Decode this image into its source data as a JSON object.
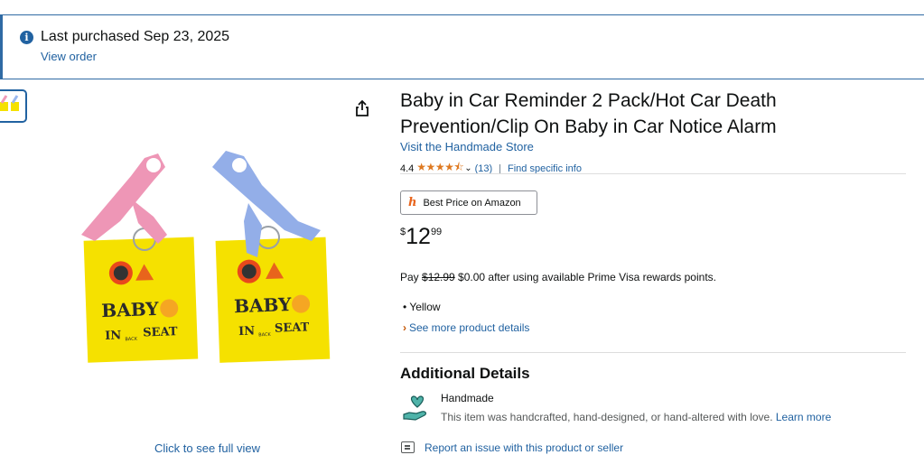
{
  "banner": {
    "icon": "info-icon",
    "title": "Last purchased Sep 23, 2025",
    "link": "View order"
  },
  "product": {
    "title": "Baby in Car Reminder 2 Pack/Hot Car Death Prevention/Clip On Baby in Car Notice Alarm",
    "store_link": "Visit the Handmade Store",
    "rating": "4.4",
    "stars": "★★★★⯪",
    "review_count": "(13)",
    "separator": "|",
    "find_info": "Find specific info",
    "best_price_label": "Best Price on Amazon",
    "price": {
      "symbol": "$",
      "whole": "12",
      "fraction": "99"
    },
    "pay_line": {
      "prefix": "Pay ",
      "strike": "$12.99",
      "suffix": " $0.00 after using available Prime Visa rewards points."
    },
    "bullets": [
      "• Yellow"
    ],
    "see_more": "See more product details",
    "image_link": "Click to see full view",
    "image_label_1": "BABY",
    "image_label_2": "IN",
    "image_label_3": "BACK",
    "image_label_4": "SEAT"
  },
  "additional": {
    "title": "Additional Details",
    "handmade_title": "Handmade",
    "handmade_desc": "This item was handcrafted, hand-designed, or hand-altered with love. ",
    "learn_more": "Learn more"
  },
  "report": {
    "label": "Report an issue with this product or seller"
  },
  "colors": {
    "link": "#2162a1",
    "star": "#de7921",
    "banner_border": "#2f6aa4",
    "sign_yellow": "#f5e100"
  }
}
